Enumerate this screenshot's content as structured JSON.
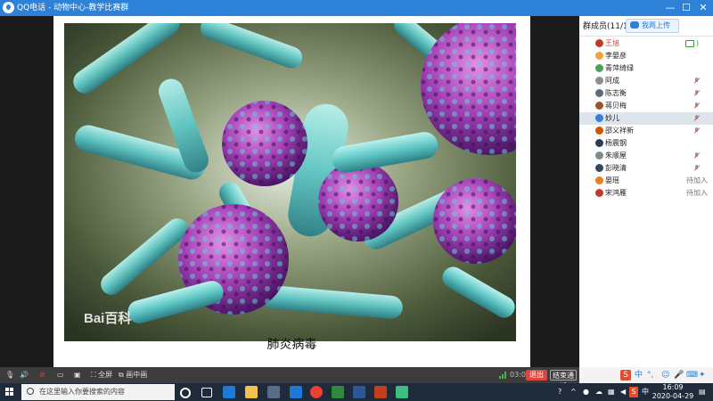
{
  "window": {
    "title": "QQ电话 - 动物中心-教学比赛群",
    "min_glyph": "—",
    "max_glyph": "☐",
    "close_glyph": "✕"
  },
  "slide": {
    "caption": "肺炎病毒",
    "watermark": "Bai百科"
  },
  "sidebar": {
    "member_count_label": "群成员(11/16)",
    "upload_label": "我两上传",
    "members": [
      {
        "name": "王旭",
        "status": "",
        "name_color": "#e23b3b",
        "avatar": "#c0392b",
        "indicator": "cam"
      },
      {
        "name": "李晏彦",
        "status": "",
        "name_color": "#222222",
        "avatar": "#f0a23a",
        "indicator": ""
      },
      {
        "name": "青萍绮绿",
        "status": "",
        "name_color": "#222222",
        "avatar": "#4aa35a",
        "indicator": ""
      },
      {
        "name": "阿成",
        "status": "",
        "name_color": "#222222",
        "avatar": "#8e8e8e",
        "indicator": "mic-off"
      },
      {
        "name": "陈志衡",
        "status": "",
        "name_color": "#222222",
        "avatar": "#5b6b7a",
        "indicator": "mic-off"
      },
      {
        "name": "蒋贝梅",
        "status": "",
        "name_color": "#222222",
        "avatar": "#a0522d",
        "indicator": "mic-off"
      },
      {
        "name": "妙儿",
        "status": "",
        "name_color": "#222222",
        "avatar": "#3b7dd8",
        "indicator": "mic-off"
      },
      {
        "name": "邵义祥新",
        "status": "",
        "name_color": "#222222",
        "avatar": "#d35400",
        "indicator": "mic-off"
      },
      {
        "name": "杨震钢",
        "status": "",
        "name_color": "#222222",
        "avatar": "#2c3e50",
        "indicator": ""
      },
      {
        "name": "朱顺屋",
        "status": "",
        "name_color": "#222222",
        "avatar": "#7f8c8d",
        "indicator": "mic-off"
      },
      {
        "name": "彭晓清",
        "status": "",
        "name_color": "#222222",
        "avatar": "#34495e",
        "indicator": "mic-off"
      },
      {
        "name": "晏瑶",
        "status": "待加入",
        "name_color": "#222222",
        "avatar": "#e67e22",
        "indicator": ""
      },
      {
        "name": "宋鸿雁",
        "status": "待加入",
        "name_color": "#222222",
        "avatar": "#c0392b",
        "indicator": ""
      }
    ]
  },
  "toolbar": {
    "fullscreen_label": "全屏",
    "pip_label": "画中画",
    "call_time": "03:06",
    "exit_label": "退出",
    "end_call_label": "结束通话"
  },
  "ime": {
    "mode_label": "中",
    "punct_label": "°,",
    "emoji_label": "☺"
  },
  "taskbar": {
    "search_placeholder": "在这里输入你要搜索的内容",
    "ime_lang": "中",
    "s_badge": "S",
    "clock_time": "16:09",
    "clock_date": "2020-04-29"
  },
  "colors": {
    "accent": "#2d81d6",
    "exit_red": "#e0443e",
    "taskbar": "#1f2a3a"
  }
}
